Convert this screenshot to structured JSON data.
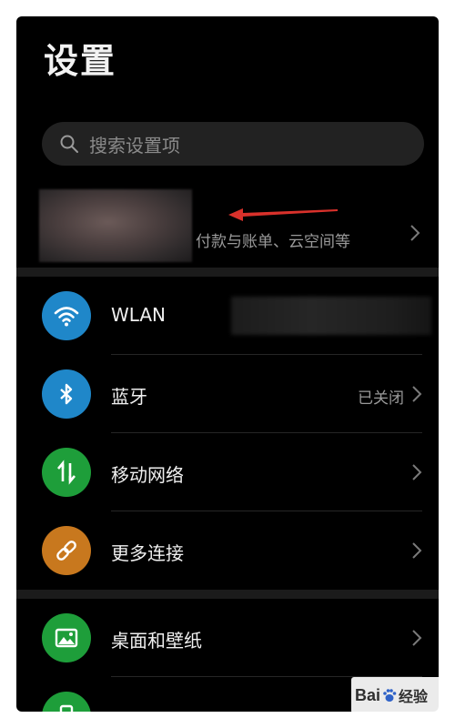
{
  "header": {
    "title": "设置"
  },
  "search": {
    "placeholder": "搜索设置项"
  },
  "account": {
    "subtitle": "付款与账单、云空间等"
  },
  "sections": {
    "connections": [
      {
        "label": "WLAN",
        "status": "",
        "icon": "wifi-icon",
        "color": "#1f87c9"
      },
      {
        "label": "蓝牙",
        "status": "已关闭",
        "icon": "bluetooth-icon",
        "color": "#1f87c9"
      },
      {
        "label": "移动网络",
        "status": "",
        "icon": "mobile-network-icon",
        "color": "#1e9e3a"
      },
      {
        "label": "更多连接",
        "status": "",
        "icon": "link-icon",
        "color": "#c8781e"
      }
    ],
    "display": [
      {
        "label": "桌面和壁纸",
        "status": "",
        "icon": "image-icon",
        "color": "#1e9e3a"
      },
      {
        "label": "",
        "status": "",
        "icon": "phone-icon",
        "color": "#1e9e3a"
      }
    ]
  },
  "watermark": {
    "brand": "Bai",
    "suffix": "经验"
  }
}
